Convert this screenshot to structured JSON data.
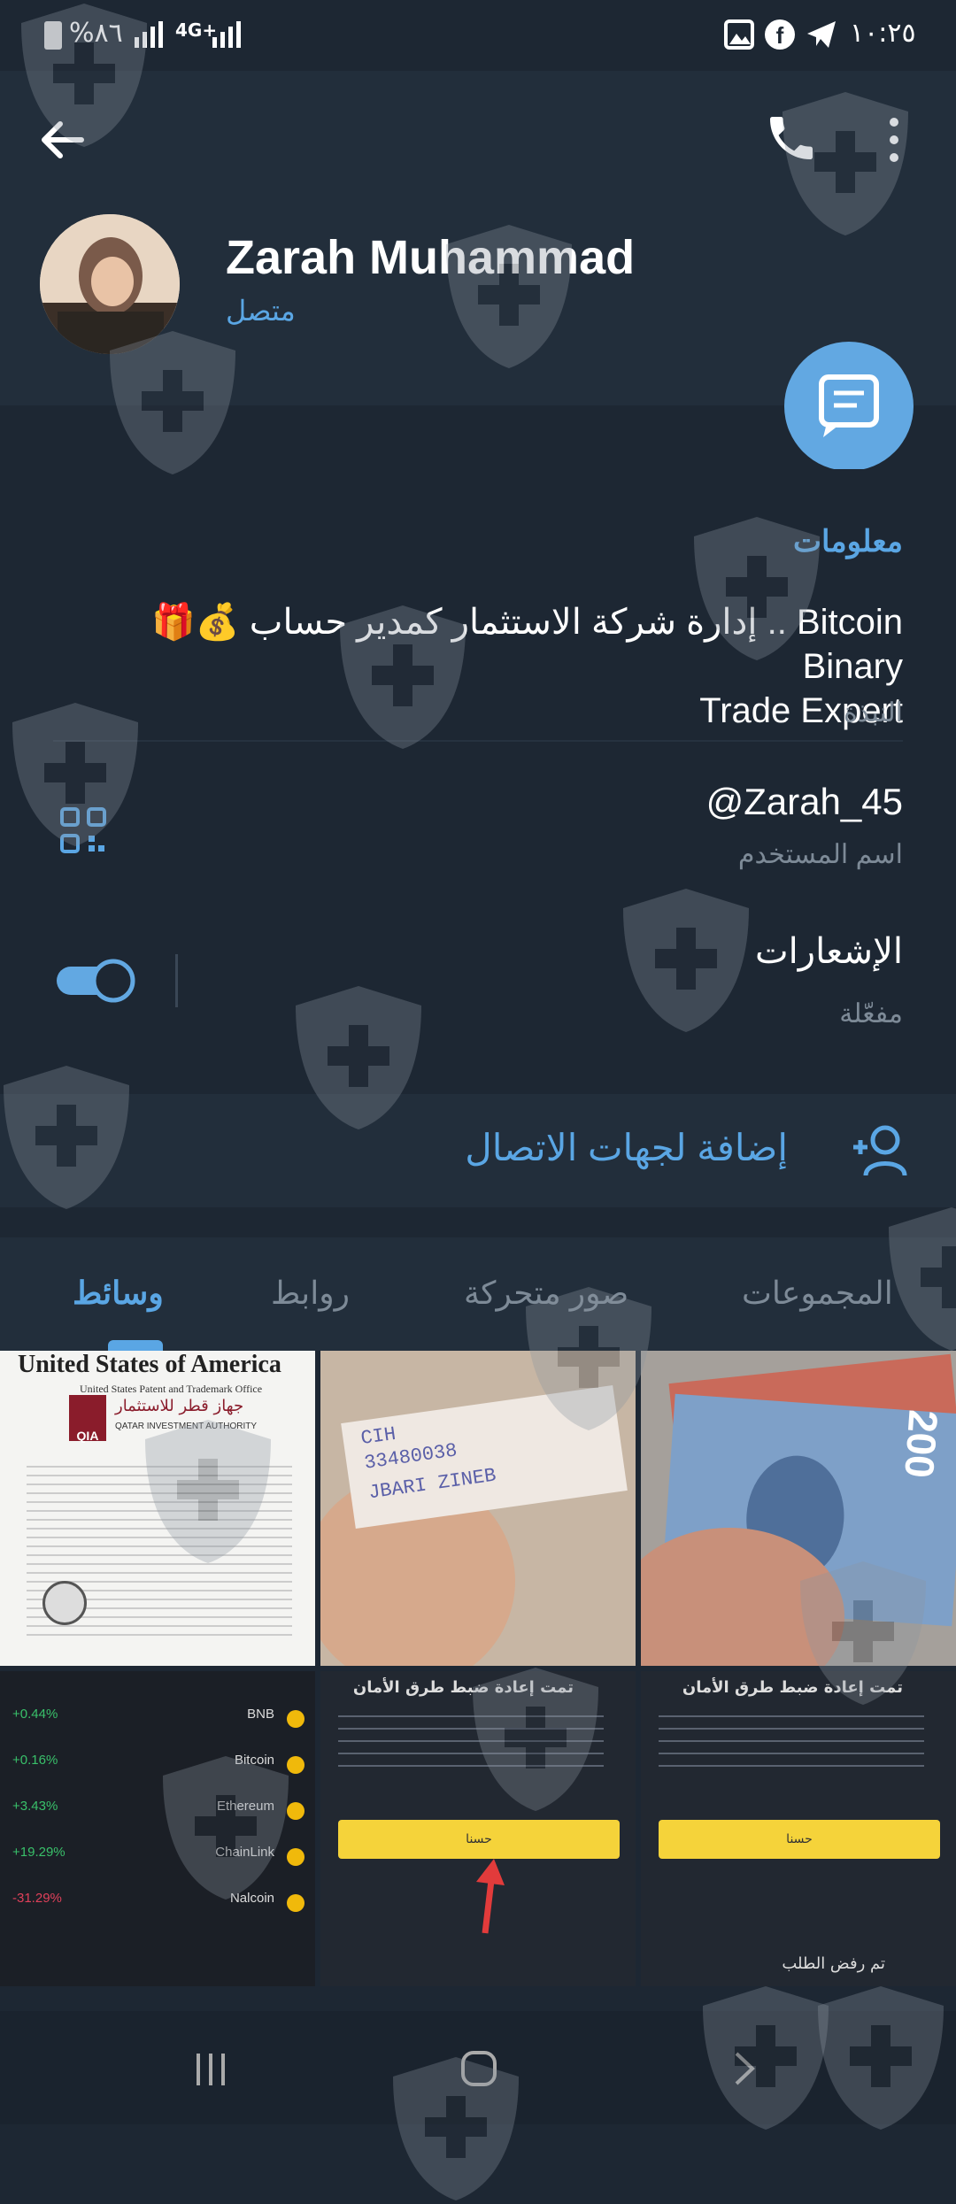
{
  "status_bar": {
    "time": "١٠:٢٥",
    "battery": "%٨٦",
    "network": "4G+"
  },
  "header": {
    "name": "Zarah Muhammad",
    "status": "متصل"
  },
  "info": {
    "section_title": "معلومات",
    "bio_line1": "Bitcoin .. إدارة شركة الاستثمار كمدير حساب 💰🎁 Binary",
    "bio_line2": "Trade Expert",
    "bio_label": "النبذة",
    "username": "@Zarah_45",
    "username_label": "اسم المستخدم",
    "notifications_title": "الإشعارات",
    "notifications_state": "مفعّلة"
  },
  "add_contact": {
    "label": "إضافة لجهات الاتصال"
  },
  "tabs": [
    {
      "label": "وسائط",
      "active": true
    },
    {
      "label": "روابط",
      "active": false
    },
    {
      "label": "صور متحركة",
      "active": false
    },
    {
      "label": "المجموعات",
      "active": false
    }
  ],
  "media": {
    "doc_title": "United States of America",
    "doc_subtitle": "United States Patent and Trademark Office",
    "doc_org_ar": "جهاز قطر للاستثمار",
    "doc_org_en": "QATAR INVESTMENT AUTHORITY",
    "doc_logo": "QIA",
    "note_line1": "CIH",
    "note_line2": "33480038",
    "note_line3": "JBARI ZINEB",
    "banknote_value": "200",
    "reset_title": "تمت إعادة ضبط طرق الأمان",
    "reset_button": "حسنا",
    "reject_text": "تم رفض الطلب",
    "crypto": [
      {
        "name": "BNB",
        "change": "+0.44%",
        "color": "#39c06a"
      },
      {
        "name": "Bitcoin",
        "change": "+0.16%",
        "color": "#39c06a"
      },
      {
        "name": "Ethereum",
        "change": "+3.43%",
        "color": "#39c06a"
      },
      {
        "name": "ChainLink",
        "change": "+19.29%",
        "color": "#39c06a"
      },
      {
        "name": "Nalcoin",
        "change": "-31.29%",
        "color": "#e0405a"
      }
    ]
  }
}
